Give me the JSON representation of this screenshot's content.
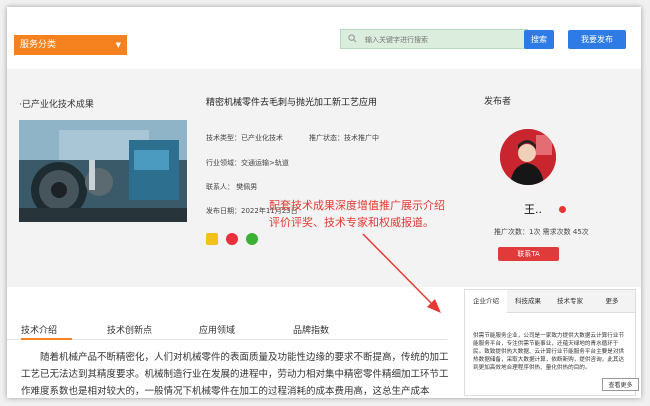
{
  "header": {
    "category_label": "服务分类",
    "search_placeholder": "输入关键字进行搜索",
    "search_button": "搜索",
    "publish_button": "我要发布"
  },
  "detail": {
    "tag": "·已产业化技术成果",
    "title": "精密机械零件去毛刺与抛光加工新工艺应用",
    "tech_type": "技术类型：已产业化技术",
    "promo_status": "推广状态：技术推广中",
    "industry": "行业领域：交通运输>轨道",
    "contact": "联系人：  樊佩男",
    "publish_date": "发布日期：2022年11月23日"
  },
  "publisher": {
    "label": "发布者",
    "name": "王..",
    "stats": "推广次数：1次    需求次数  45次",
    "contact_button": "联系TA"
  },
  "overlay_text": {
    "line1": "配套技术成果深度增值推广展示介绍",
    "line2": "评价评奖、技术专家和权威报道。"
  },
  "tabs": [
    "技术介绍",
    "技术创新点",
    "应用领域",
    "品牌指数"
  ],
  "body_text": "随着机械产品不断精密化，人们对机械零件的表面质量及功能性边缘的要求不断提高，传统的加工工艺已无法达到其精度要求。机械制造行业在发展的进程中，劳动力相对集中精密零件精细加工环节工作难度系数也是相对较大的，一般情况下机械零件在加工的过程消耗的成本费用高，这总生产成本",
  "right_panel": {
    "tabs": [
      "企业介绍",
      "科技成果",
      "技术专家",
      "更多"
    ],
    "text": "供需节能服务企业，公司是一家致力提供大数据云计算行业节能服务平台，专注供需节能事业，还蕴天绿地的青水循环于民。致致提供热大数据、云计算行业节能服务平台主要是对供热数据储备，采取大数据计算，依断新购，提供咨询，此其达到更加高效地合理程序供热、量化供热的目的。",
    "more_button": "查看更多"
  },
  "colors": {
    "accent_orange": "#f5821f",
    "primary_blue": "#2f7be5",
    "contact_red": "#e03a3a",
    "overlay_red": "#e53935"
  }
}
